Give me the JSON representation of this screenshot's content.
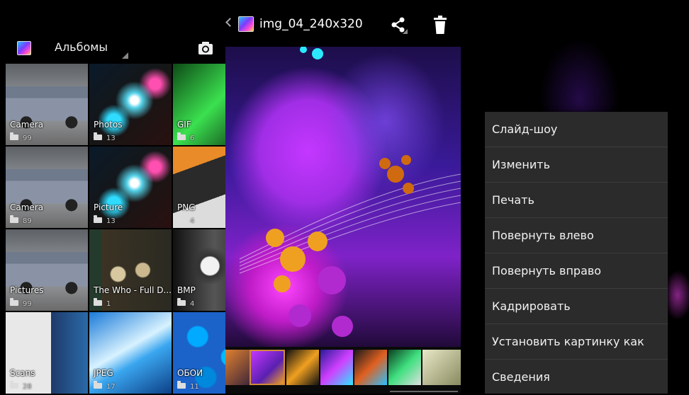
{
  "albums_bar": {
    "title": "Альбомы"
  },
  "albums": [
    {
      "name": "Camera",
      "count": "99"
    },
    {
      "name": "Photos",
      "count": "13"
    },
    {
      "name": "GIF",
      "count": "6"
    },
    {
      "name": "Camera",
      "count": "89"
    },
    {
      "name": "Picture",
      "count": "13"
    },
    {
      "name": "PNG",
      "count": "4"
    },
    {
      "name": "Pictures",
      "count": "99"
    },
    {
      "name": "The Who - Full D...",
      "count": "1"
    },
    {
      "name": "BMP",
      "count": "4"
    },
    {
      "name": "Scans",
      "count": "28"
    },
    {
      "name": "JPEG",
      "count": "17"
    },
    {
      "name": "ОБОИ",
      "count": "11"
    }
  ],
  "photo": {
    "title": "img_04_240x320"
  },
  "menu": {
    "items": [
      "Слайд-шоу",
      "Изменить",
      "Печать",
      "Повернуть влево",
      "Повернуть вправо",
      "Кадрировать",
      "Установить картинку как",
      "Сведения"
    ]
  },
  "colors": {
    "menu_bg": "#2b2b2b",
    "filmstrip_highlight": "#d08a3a"
  }
}
